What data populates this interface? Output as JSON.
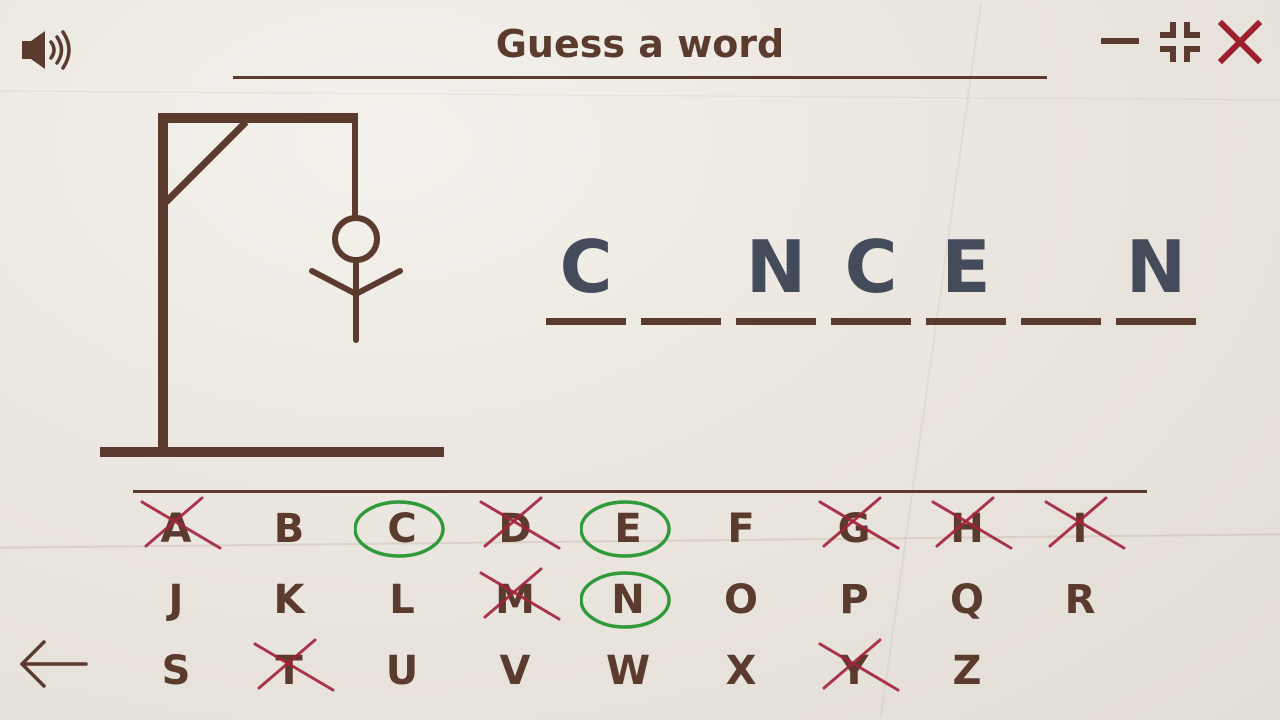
{
  "header": {
    "title": "Guess a word"
  },
  "colors": {
    "ink": "#5a3b2d",
    "word_letters": "#444b5a",
    "wrong_mark": "#a3223a",
    "correct_mark": "#2f9a3a",
    "close_icon": "#9c1f2f"
  },
  "icons": {
    "sound": "speaker-icon",
    "minimize": "minimize-icon",
    "restore": "restore-window-icon",
    "close": "close-icon",
    "back": "back-arrow-icon"
  },
  "word": {
    "slots": [
      {
        "letter": "C"
      },
      {
        "letter": ""
      },
      {
        "letter": "N"
      },
      {
        "letter": "C"
      },
      {
        "letter": "E"
      },
      {
        "letter": ""
      },
      {
        "letter": "N"
      }
    ]
  },
  "keyboard": {
    "keys": [
      {
        "label": "A",
        "state": "wrong"
      },
      {
        "label": "B",
        "state": "unused"
      },
      {
        "label": "C",
        "state": "correct"
      },
      {
        "label": "D",
        "state": "wrong"
      },
      {
        "label": "E",
        "state": "correct"
      },
      {
        "label": "F",
        "state": "unused"
      },
      {
        "label": "G",
        "state": "wrong"
      },
      {
        "label": "H",
        "state": "wrong"
      },
      {
        "label": "I",
        "state": "wrong"
      },
      {
        "label": "J",
        "state": "unused"
      },
      {
        "label": "K",
        "state": "unused"
      },
      {
        "label": "L",
        "state": "unused"
      },
      {
        "label": "M",
        "state": "wrong"
      },
      {
        "label": "N",
        "state": "correct"
      },
      {
        "label": "O",
        "state": "unused"
      },
      {
        "label": "P",
        "state": "unused"
      },
      {
        "label": "Q",
        "state": "unused"
      },
      {
        "label": "R",
        "state": "unused"
      },
      {
        "label": "S",
        "state": "unused"
      },
      {
        "label": "T",
        "state": "wrong"
      },
      {
        "label": "U",
        "state": "unused"
      },
      {
        "label": "V",
        "state": "unused"
      },
      {
        "label": "W",
        "state": "unused"
      },
      {
        "label": "X",
        "state": "unused"
      },
      {
        "label": "Y",
        "state": "wrong"
      },
      {
        "label": "Z",
        "state": "unused"
      }
    ]
  },
  "hangman": {
    "parts_shown": [
      "head",
      "body",
      "left-arm",
      "right-arm"
    ]
  }
}
